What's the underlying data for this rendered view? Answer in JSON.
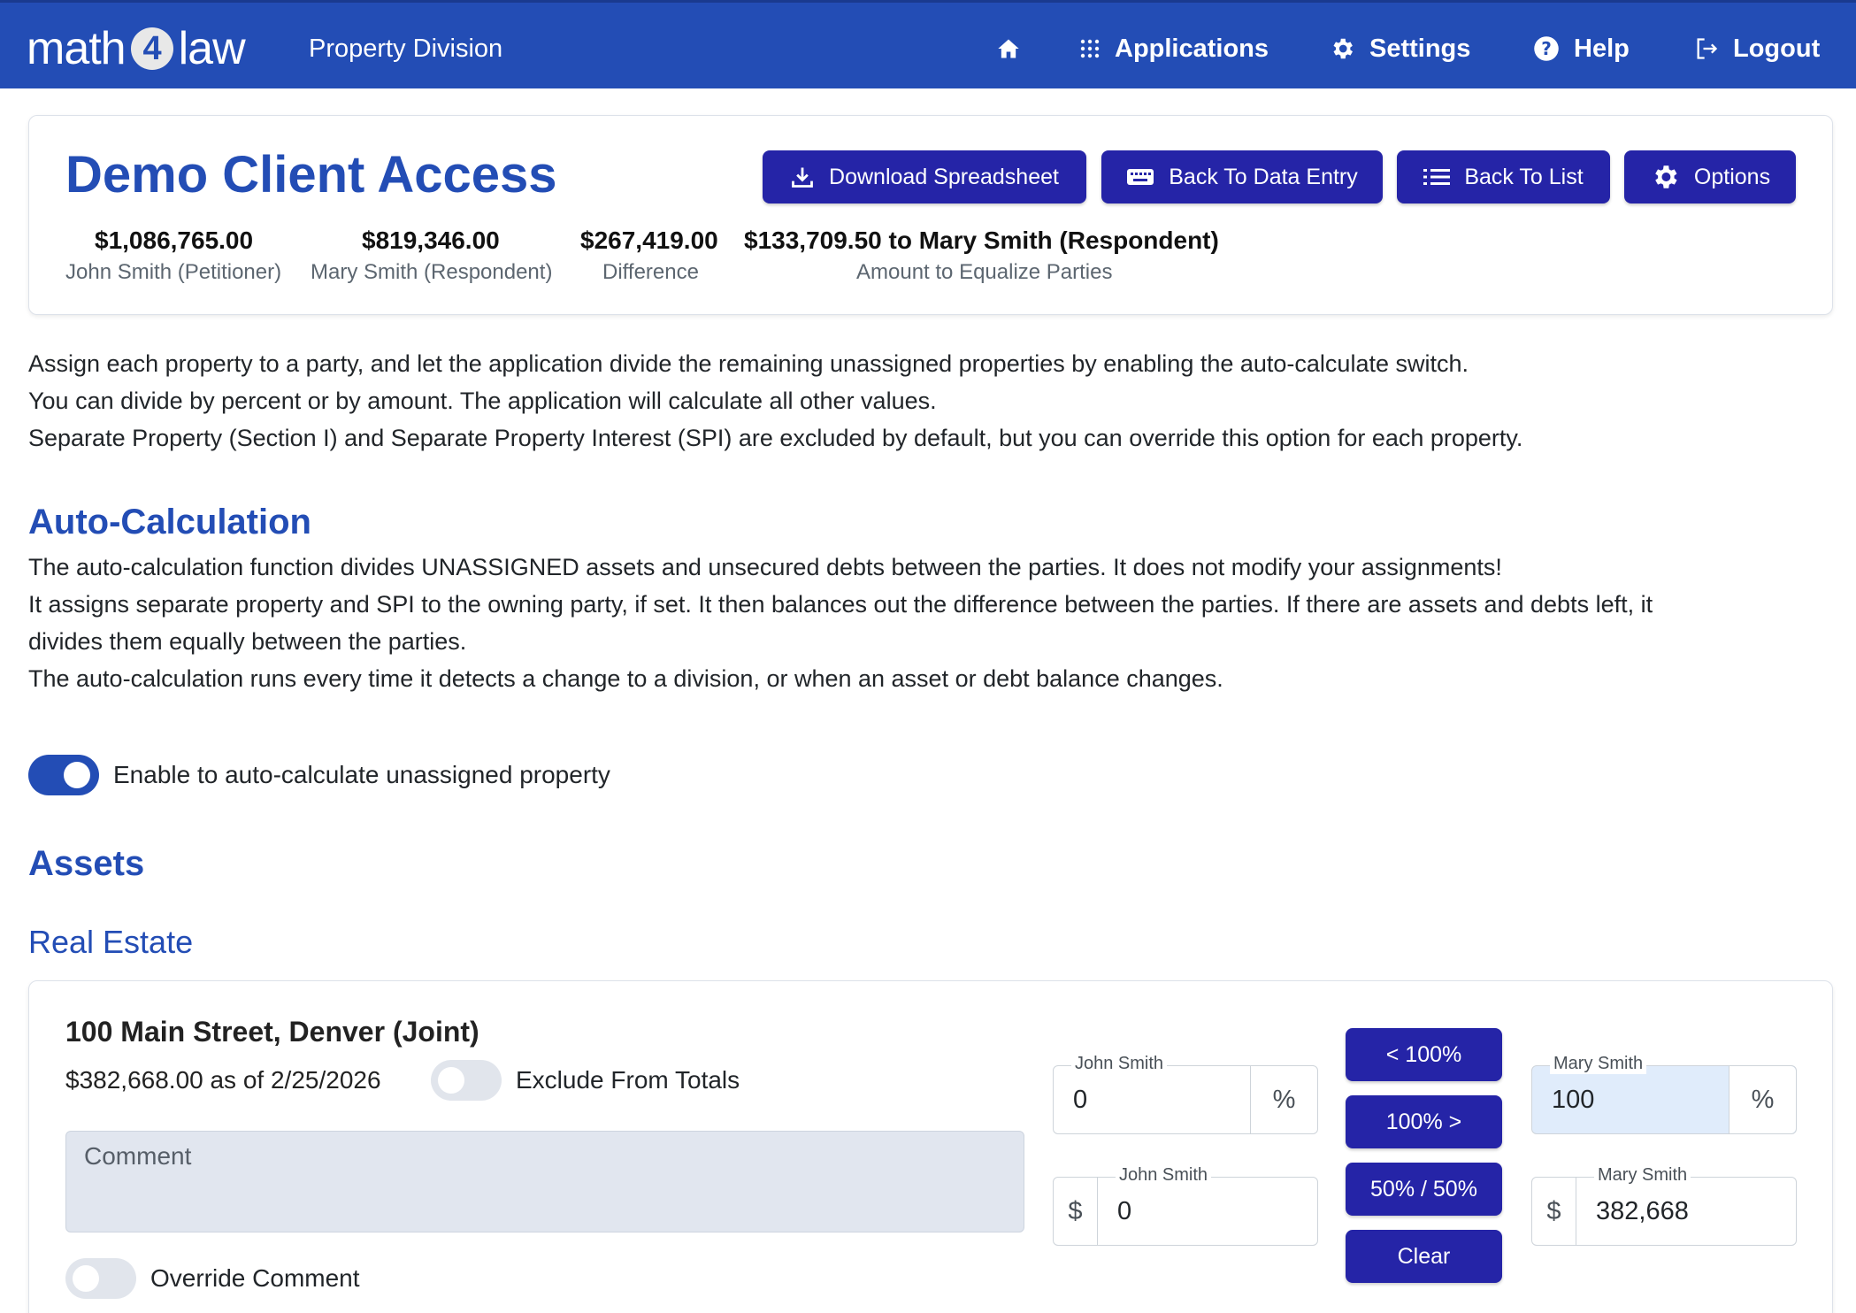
{
  "navbar": {
    "brand_left": "math",
    "brand_digit": "4",
    "brand_right": "law",
    "division": "Property Division",
    "home_icon": "home-icon",
    "items": [
      {
        "label": "Applications",
        "icon": "grid-icon"
      },
      {
        "label": "Settings",
        "icon": "gear-icon"
      },
      {
        "label": "Help",
        "icon": "question-circle-icon"
      },
      {
        "label": "Logout",
        "icon": "logout-icon"
      }
    ]
  },
  "header": {
    "title": "Demo Client Access",
    "buttons": [
      {
        "label": "Download Spreadsheet",
        "icon": "download-icon"
      },
      {
        "label": "Back To Data Entry",
        "icon": "keyboard-icon"
      },
      {
        "label": "Back To List",
        "icon": "list-icon"
      },
      {
        "label": "Options",
        "icon": "gear-icon"
      }
    ],
    "summary": [
      {
        "value": "$1,086,765.00",
        "label": "John Smith (Petitioner)"
      },
      {
        "value": "$819,346.00",
        "label": "Mary Smith (Respondent)"
      },
      {
        "value": "$267,419.00",
        "label": "Difference"
      },
      {
        "value": "$133,709.50 to Mary Smith (Respondent)",
        "label": "Amount to Equalize Parties"
      }
    ]
  },
  "intro": {
    "lines": [
      "Assign each property to a party, and let the application divide the remaining unassigned properties by enabling the auto-calculate switch.",
      "You can divide by percent or by amount. The application will calculate all other values.",
      "Separate Property (Section I) and Separate Property Interest (SPI) are excluded by default, but you can override this option for each property."
    ]
  },
  "auto_calc": {
    "heading": "Auto-Calculation",
    "lines": [
      "The auto-calculation function divides UNASSIGNED assets and unsecured debts between the parties. It does not modify your assignments!",
      "It assigns separate property and SPI to the owning party, if set. It then balances out the difference between the parties. If there are assets and debts left, it",
      "divides them equally between the parties.",
      "The auto-calculation runs every time it detects a change to a division, or when an asset or debt balance changes."
    ],
    "toggle_label": "Enable to auto-calculate unassigned property",
    "toggle_on": true
  },
  "assets": {
    "heading": "Assets",
    "subheading": "Real Estate",
    "property": {
      "title": "100 Main Street, Denver (Joint)",
      "value_text": "$382,668.00 as of 2/25/2026",
      "exclude_label": "Exclude From Totals",
      "exclude_on": false,
      "comment_placeholder": "Comment",
      "override_label": "Override Comment",
      "override_on": false,
      "john": {
        "name": "John Smith",
        "percent": "0",
        "percent_unit": "%",
        "amount_unit": "$",
        "amount": "0"
      },
      "mary": {
        "name": "Mary Smith",
        "percent": "100",
        "percent_unit": "%",
        "amount_unit": "$",
        "amount": "382,668"
      },
      "split_buttons": [
        "< 100%",
        "100% >",
        "50% / 50%",
        "Clear"
      ]
    }
  },
  "colors": {
    "primary": "#234db5",
    "button": "#2524a7",
    "toggle_off": "#e1e5ec",
    "highlight_field": "#e0ecfb"
  }
}
